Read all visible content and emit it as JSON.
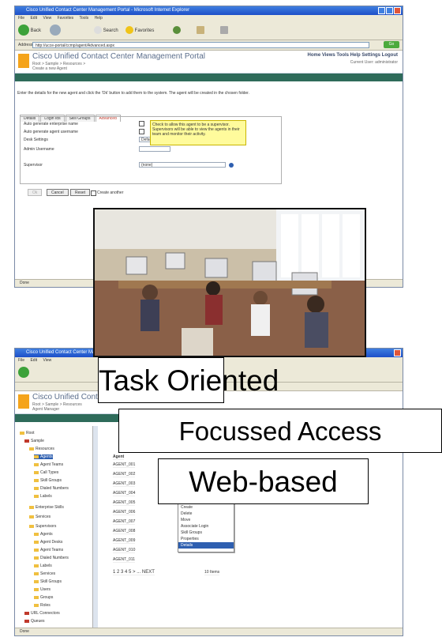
{
  "window1": {
    "title": "Cisco Unified Contact Center Management Portal - Microsoft Internet Explorer",
    "menu": [
      "File",
      "Edit",
      "View",
      "Favorites",
      "Tools",
      "Help"
    ],
    "toolbar": {
      "back": "Back",
      "search": "Search",
      "favorites": "Favorites"
    },
    "address_label": "Address",
    "address_value": "http://ucce-portal/ccmp/agent/Advanced.aspx",
    "go": "Go",
    "portal": {
      "title": "Cisco Unified Contact Center Management Portal",
      "breadcrumb": "Root > Sample > Resources >",
      "subtitle": "Create a new Agent",
      "links": "Home  Views  Tools  Help  Settings  Logout",
      "user": "Current User: administrator"
    },
    "instructions": "Enter the details for the new agent and click the 'Ok' button to add them to the system. The agent will be created in the chosen folder.",
    "tabs": [
      "Details",
      "Login Ids",
      "Skill Groups",
      "Advanced"
    ],
    "form": {
      "rows": [
        "Auto generate enterprise name",
        "Auto generate agent username",
        "Desk Settings",
        "Admin Username",
        "Supervisor"
      ],
      "desk_value": "Default",
      "supervisor_value": "(none)",
      "tooltip": "Check to allow this agent to be a supervisor. Supervisors will be able to view the agents in their team and monitor their activity."
    },
    "buttons": {
      "ok": "Ok",
      "cancel": "Cancel",
      "reset": "Reset",
      "checkbox_label": "Create another"
    },
    "status": "Done"
  },
  "photo": {
    "label": "Contact center office"
  },
  "window2": {
    "title": "Cisco Unified Contact Center Management Portal - Microsoft Internet Explorer",
    "portal": {
      "title": "Cisco Unified Contact Center Management Portal",
      "breadcrumb": "Root > Sample > Resources",
      "subtitle": "Agent Manager"
    },
    "tree": [
      "Root",
      "Sample",
      "Resources",
      "Agents",
      "Agent Teams",
      "Call Types",
      "Skill Groups",
      "Dialed Numbers",
      "Labels",
      "Enterprise Skills",
      "Services",
      "Supervisors",
      "Agents",
      "Agent Desks",
      "Agent Teams",
      "Dialed Numbers",
      "Labels",
      "Services",
      "Skill Groups",
      "Users",
      "Groups",
      "Roles",
      "URL Connectors",
      "Queues",
      "Labels"
    ],
    "list_header": "Agent",
    "list_rows": [
      "AGENT_001",
      "AGENT_002",
      "AGENT_003",
      "AGENT_004",
      "AGENT_005",
      "AGENT_006",
      "AGENT_007",
      "AGENT_008",
      "AGENT_009",
      "AGENT_010",
      "AGENT_011"
    ],
    "context_menu": [
      "Create",
      "Delete",
      "Move",
      "Associate Login",
      "Skill Groups",
      "Properties",
      "Details"
    ],
    "pager": "1 2 3 4 5 > ... NEXT",
    "count": "10 Items",
    "status": "Done"
  },
  "callouts": [
    "Task Oriented",
    "Focussed Access",
    "Web-based"
  ]
}
